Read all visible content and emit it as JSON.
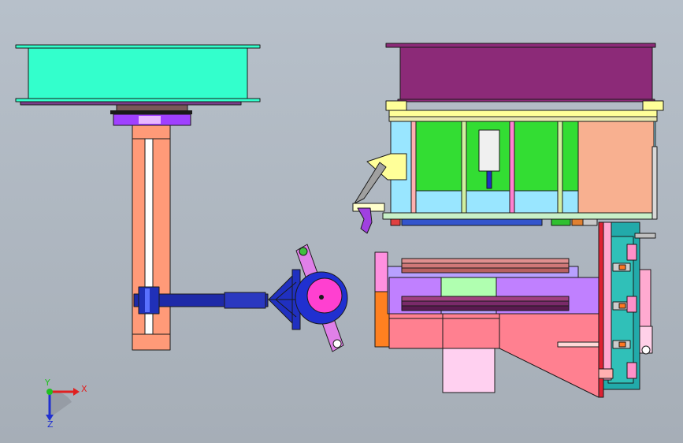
{
  "view": {
    "background_top": "#b7c0ca",
    "background_bottom": "#a6aeb7"
  },
  "triad": {
    "x_label": "X",
    "y_label": "Y",
    "z_label": "Z",
    "x_color": "#e02020",
    "y_color": "#20c020",
    "z_color": "#2030d0"
  },
  "colors": {
    "outline": "#1a1a1a",
    "cyan_tray": "#33ffcc",
    "magenta_tray": "#8c2a78",
    "purple_plate": "#7a3e8a",
    "salmon_column": "#ff9a78",
    "lavender": "#b8a0ff",
    "violet_disc": "#a040ff",
    "navy_arm": "#1e2aa8",
    "magenta_hub": "#ff40d0",
    "pink_link": "#e080e8",
    "light_blue": "#99e6ff",
    "green_panel": "#33dd33",
    "peach_panel": "#f8b090",
    "yellow_bracket": "#ffff99",
    "steel_blue": "#3355cc",
    "pink_block": "#ff8090",
    "rose_block": "#ffa0b0",
    "violet_block": "#c080ff",
    "orange_strip": "#ff8020",
    "mint": "#b0ffb0",
    "teal": "#22aaaa",
    "red_rail": "#dd2233",
    "pale_pink": "#ffd0f0",
    "orange_bolt": "#ff7722"
  }
}
